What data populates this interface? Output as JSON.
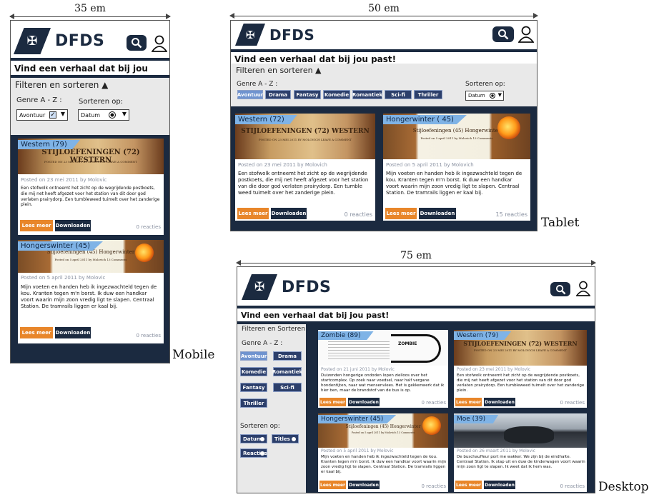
{
  "dimensions": {
    "mobile": "35 em",
    "tablet": "50 em",
    "desktop": "75 em"
  },
  "view_labels": {
    "mobile": "Mobile",
    "tablet": "Tablet",
    "desktop": "Desktop"
  },
  "brand": {
    "name": "DFDS",
    "color": "#1b2a40",
    "accent": "#e8862a",
    "tag_color": "#7fb3e6"
  },
  "tagline": "Vind een verhaal dat bij jou past!",
  "filter": {
    "title_mobile": "Filteren en sorteren ▲",
    "title_tablet": "Filteren en sorteren ▲",
    "title_desktop": "Filteren en Sorteren",
    "genre_label": "Genre A - Z :",
    "genre_label_tablet": "Genre A - Z :",
    "sort_label": "Sorteren op:",
    "genre_select_value": "Avontuur",
    "sort_select_value": "Datum",
    "genres": [
      "Avontuur",
      "Drama",
      "Fantasy",
      "Komedie",
      "Romantiek",
      "Sci-fi",
      "Thriller"
    ],
    "genres_desktop": [
      "Avontuur",
      "Drama",
      "Komedie",
      "Romantiek",
      "Fantasy",
      "Sci-fi",
      "Thriller"
    ],
    "sort_options": [
      "Datum",
      "Titles",
      "Reacties"
    ]
  },
  "buttons": {
    "lees_meer": "Lees meer",
    "downloaden": "Downloaden"
  },
  "stories": {
    "western": {
      "tag_mobile": "Western (79)",
      "tag_tablet": "Western (72)",
      "tag_desktop": "Western (79)",
      "image_title": "STIJLOEFENINGEN (72) WESTERN",
      "image_sub": "POSTED ON 23 MEI 2011 BY MOLOVICH  LEAVE A COMMENT",
      "meta": "Posted on 23 mei 2011 by Molovic",
      "meta_tablet": "Posted on 23 mei 2011 by Molovich",
      "text": "Een stofwolk ontneemt het zicht op de wegrijdende postkoets, die mij net heeft afgezet voor het station van dit door god verlaten prairydorp. Een tumbleweed tuimelt over het zanderige plein.",
      "text_tablet": "Een stofwolk ontneemt het zicht op de wegrijdende postkoets, die mij net heeft afgezet voor het station van die door god verlaten prairydorp. Een tumble weed tuimelt over het zanderige plein.",
      "reacties": "0 reacties"
    },
    "honger": {
      "tag_mobile": "Hongerswinter (45)",
      "tag_tablet": "Hongerwinter ( 45)",
      "tag_desktop": "Hongerswinter (45)",
      "image_title": "Stijloefeningen (45) Hongerwinter",
      "image_sub": "Posted on 5 april 2011 by Molovich  13 Comments",
      "meta": "Posted on 5  april 2011 by Molovic",
      "meta_tablet": "Posted on 5 april 2011 by Molovich",
      "text": "Mijn voeten en handen heb ik ingezwachteld tegen de kou. Kranten tegen m'n borst. Ik duw een handkar voort waarin mijn zoon vredig ligt te slapen. Centraal Station. De tramrails liggen er kaal bij.",
      "text_tablet": "Mijn voeten en handen heb ik ingezwachteld tegen de kou. Kranten tegen m'n borst. Ik duw een handkar voort waarin mijn zoon vredig ligt te slapen. Centraal Station. De tramrails liggen er kaal bij.",
      "reacties": "0 reacties",
      "reacties_tablet": "15 reacties"
    },
    "zombie": {
      "tag": "Zombie (89)",
      "image_title": "ZOMBIE",
      "meta": "Posted on 21 juni 2011 by Molovic",
      "text": "Duizenden hongerige ondoden lopen zielloos over het startcomplex. Op zoek naar voedsel, naar half vergane hondentijten, naar wat mensenvlees. Het is gekkenwerk dat ik hier ben, maar de brandstof van de bus is op.",
      "reacties": "0 reacties"
    },
    "moe": {
      "tag": "Moe (39)",
      "meta": "Posted on 26 maart 2011 by Molovic",
      "text": "De buschauffeur port me wakker. We zijn bij de eindhalte. Centraal Station. Ik stap uit en duw de kinderwagen voort waarin mijn zoon ligt te slapen. Ik weet dat ik hem was.",
      "reacties": "0 reacties"
    }
  }
}
